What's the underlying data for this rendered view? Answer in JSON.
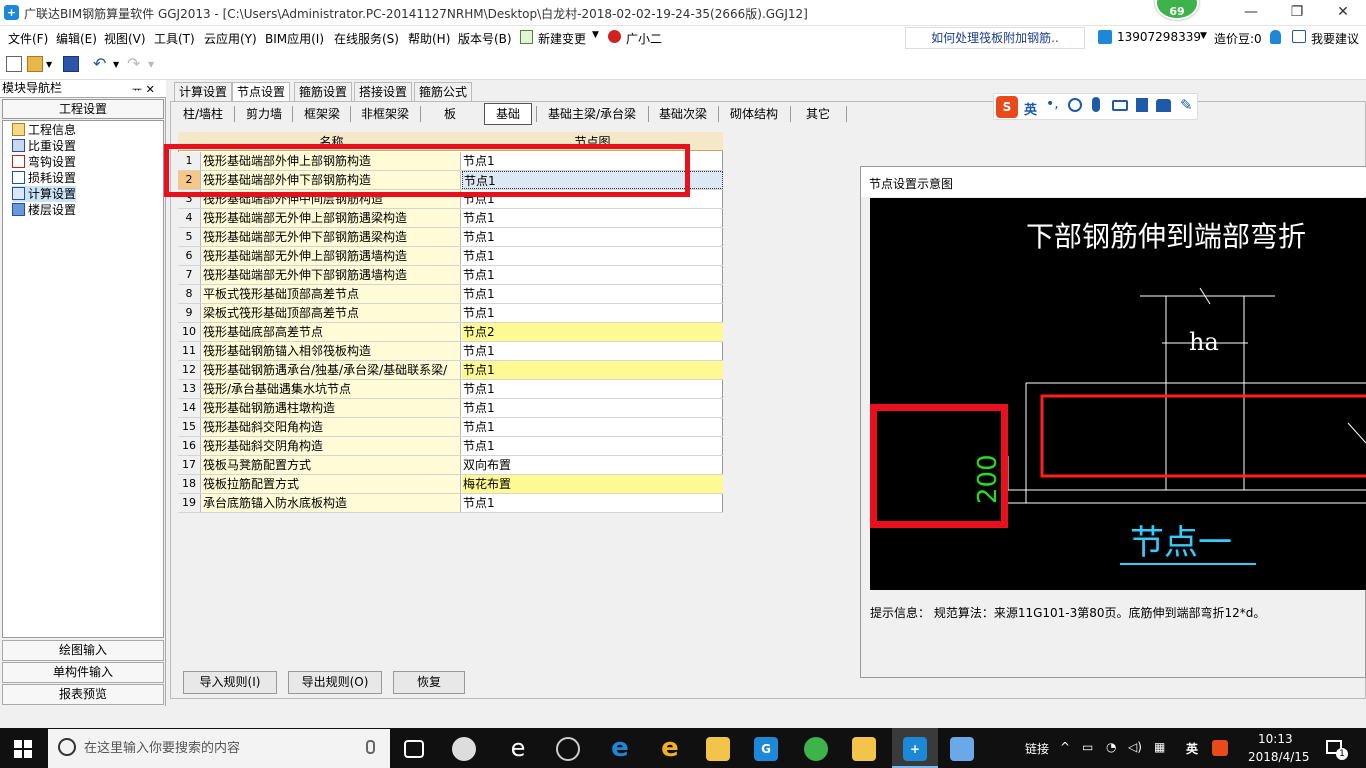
{
  "window": {
    "title": "广联达BIM钢筋算量软件 GGJ2013 - [C:\\Users\\Administrator.PC-20141127NRHM\\Desktop\\白龙村-2018-02-02-19-24-35(2666版).GGJ12]",
    "badge": "69",
    "minimize": "—",
    "maximize": "❐",
    "close": "✕"
  },
  "menu": [
    "文件(F)",
    "编辑(E)",
    "视图(V)",
    "工具(T)",
    "云应用(Y)",
    "BIM应用(I)",
    "在线服务(S)",
    "帮助(H)",
    "版本号(B)",
    "新建变更",
    "广小二"
  ],
  "news": "如何处理筏板附加钢筋..",
  "account": {
    "phone": "13907298339",
    "credits": "造价豆:0",
    "suggest": "我要建议"
  },
  "nav": {
    "title": "模块导航栏",
    "pin": "ᅲ ✕",
    "section": "工程设置",
    "items": [
      "工程信息",
      "比重设置",
      "弯钩设置",
      "损耗设置",
      "计算设置",
      "楼层设置"
    ],
    "bottom": [
      "绘图输入",
      "单构件输入",
      "报表预览"
    ]
  },
  "tabs": [
    "计算设置",
    "节点设置",
    "箍筋设置",
    "搭接设置",
    "箍筋公式"
  ],
  "subtabs": [
    "柱/墙柱",
    "剪力墙",
    "框架梁",
    "非框架梁",
    "板",
    "基础",
    "基础主梁/承台梁",
    "基础次梁",
    "砌体结构",
    "其它"
  ],
  "grid": {
    "col_name": "名称",
    "col_val": "节点图",
    "rows": [
      {
        "i": "1",
        "n": "筏形基础端部外伸上部钢筋构造",
        "v": "节点1"
      },
      {
        "i": "2",
        "n": "筏形基础端部外伸下部钢筋构造",
        "v": "节点1"
      },
      {
        "i": "3",
        "n": "筏形基础端部外伸中间层钢筋构造",
        "v": "节点1"
      },
      {
        "i": "4",
        "n": "筏形基础端部无外伸上部钢筋遇梁构造",
        "v": "节点1"
      },
      {
        "i": "5",
        "n": "筏形基础端部无外伸下部钢筋遇梁构造",
        "v": "节点1"
      },
      {
        "i": "6",
        "n": "筏形基础端部无外伸上部钢筋遇墙构造",
        "v": "节点1"
      },
      {
        "i": "7",
        "n": "筏形基础端部无外伸下部钢筋遇墙构造",
        "v": "节点1"
      },
      {
        "i": "8",
        "n": "平板式筏形基础顶部高差节点",
        "v": "节点1"
      },
      {
        "i": "9",
        "n": "梁板式筏形基础顶部高差节点",
        "v": "节点1"
      },
      {
        "i": "10",
        "n": "筏形基础底部高差节点",
        "v": "节点2"
      },
      {
        "i": "11",
        "n": "筏形基础钢筋锚入相邻筏板构造",
        "v": "节点1"
      },
      {
        "i": "12",
        "n": "筏形基础钢筋遇承台/独基/承台梁/基础联系梁/",
        "v": "节点1"
      },
      {
        "i": "13",
        "n": "筏形/承台基础遇集水坑节点",
        "v": "节点1"
      },
      {
        "i": "14",
        "n": "筏形基础钢筋遇柱墩构造",
        "v": "节点1"
      },
      {
        "i": "15",
        "n": "筏形基础斜交阳角构造",
        "v": "节点1"
      },
      {
        "i": "16",
        "n": "筏形基础斜交阴角构造",
        "v": "节点1"
      },
      {
        "i": "17",
        "n": "筏板马凳筋配置方式",
        "v": "双向布置"
      },
      {
        "i": "18",
        "n": "筏板拉筋配置方式",
        "v": "梅花布置"
      },
      {
        "i": "19",
        "n": "承台底筋锚入防水底板构造",
        "v": "节点1"
      }
    ]
  },
  "buttons": {
    "import": "导入规则(I)",
    "export": "导出规则(O)",
    "restore": "恢复"
  },
  "panel": {
    "title": "节点设置示意图",
    "heading": "下部钢筋伸到端部弯折",
    "ha": "ha",
    "dim": "200",
    "node": "节点一",
    "hint": "提示信息：  规范算法：来源11G101-3第80页。底筋伸到端部弯折12*d。"
  },
  "ime": {
    "lang": "英"
  },
  "taskbar": {
    "search": "在这里输入你要搜索的内容",
    "link": "链接",
    "ime": "英",
    "time": "10:13",
    "date": "2018/4/15",
    "notif": "1"
  }
}
